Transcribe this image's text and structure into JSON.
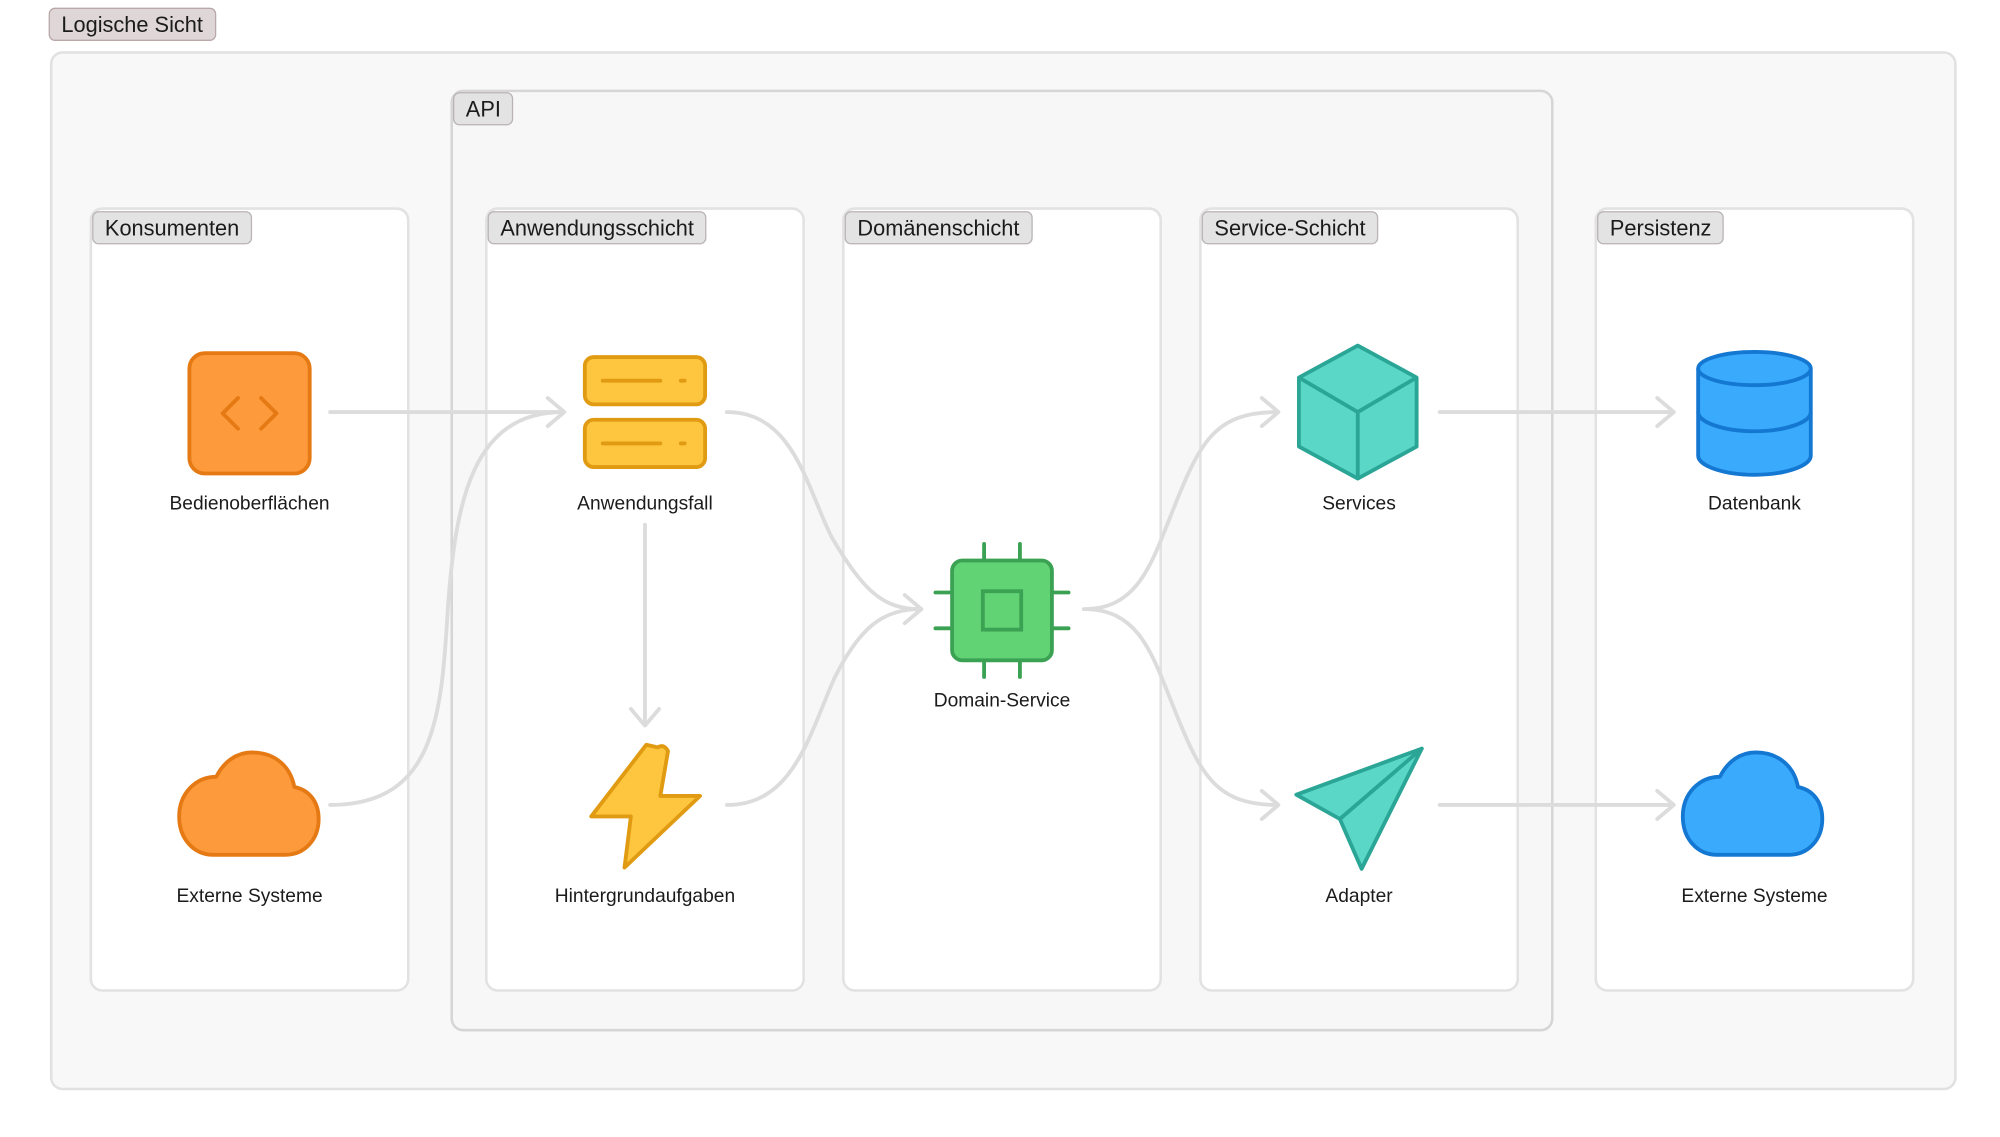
{
  "outer": {
    "label": "Logische Sicht"
  },
  "api": {
    "label": "API"
  },
  "columns": {
    "konsumenten": "Konsumenten",
    "anwendungsschicht": "Anwendungsschicht",
    "domaenenschicht": "Domänenschicht",
    "service_schicht": "Service-Schicht",
    "persistenz": "Persistenz"
  },
  "nodes": {
    "bedienoberflaechen": {
      "label": "Bedienoberflächen",
      "icon": "code-window-icon",
      "color": "#fd9a3c"
    },
    "externe_systeme_1": {
      "label": "Externe Systeme",
      "icon": "cloud-icon",
      "color": "#fd9a3c"
    },
    "anwendungsfall": {
      "label": "Anwendungsfall",
      "icon": "server-icon",
      "color": "#fec53f"
    },
    "hintergrundaufgaben": {
      "label": "Hintergrundaufgaben",
      "icon": "lightning-icon",
      "color": "#fec53f"
    },
    "domain_service": {
      "label": "Domain-Service",
      "icon": "chip-icon",
      "color": "#62d375"
    },
    "services": {
      "label": "Services",
      "icon": "cube-icon",
      "color": "#5bd7c8"
    },
    "adapter": {
      "label": "Adapter",
      "icon": "paper-plane-icon",
      "color": "#5bd7c8"
    },
    "datenbank": {
      "label": "Datenbank",
      "icon": "database-icon",
      "color": "#3aabfc"
    },
    "externe_systeme_2": {
      "label": "Externe Systeme",
      "icon": "cloud-icon",
      "color": "#3aabfc"
    }
  }
}
